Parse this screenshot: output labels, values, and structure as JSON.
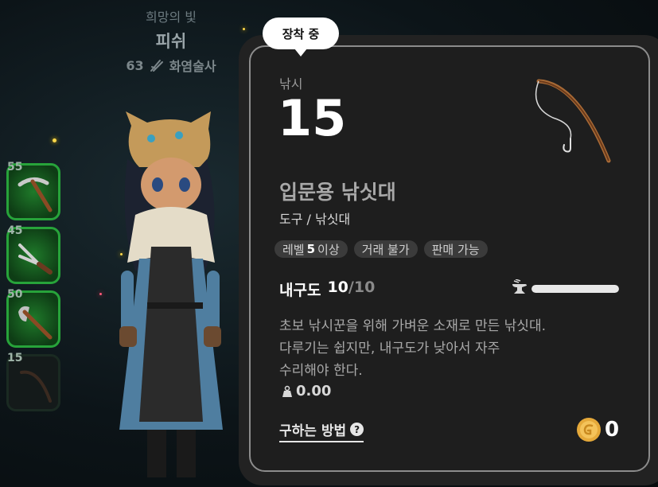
{
  "character": {
    "title": "희망의 빛",
    "name": "피쉬",
    "level": "63",
    "class": "화염술사"
  },
  "skill_slots": [
    {
      "level": "55",
      "tool": "pickaxe",
      "active": true
    },
    {
      "level": "45",
      "tool": "shears",
      "active": true
    },
    {
      "level": "50",
      "tool": "axe",
      "active": true
    },
    {
      "level": "15",
      "tool": "fishing-rod",
      "active": false
    }
  ],
  "tooltip": {
    "badge": "장착 중",
    "skill_name": "낚시",
    "skill_level": "15",
    "item_name": "입문용 낚싯대",
    "item_category": "도구 / 낚싯대",
    "tags": {
      "level_prefix": "레벨",
      "level_value": "5",
      "level_suffix": "이상",
      "trade": "거래 불가",
      "sell": "판매 가능"
    },
    "durability": {
      "label": "내구도",
      "current": "10",
      "max": "/10",
      "fraction": 1.0
    },
    "description": "초보 낚시꾼을 위해 가벼운 소재로 만든 낚싯대.\n다루기는 쉽지만, 내구도가 낮아서 자주\n수리해야 한다.",
    "weight": "0.00",
    "howto_label": "구하는 방법",
    "price": "0"
  },
  "colors": {
    "card_bg": "#1e1e1e",
    "card_border": "#8c8c8c",
    "slot_active": "#27a33a",
    "coin": "#e5a93a"
  }
}
